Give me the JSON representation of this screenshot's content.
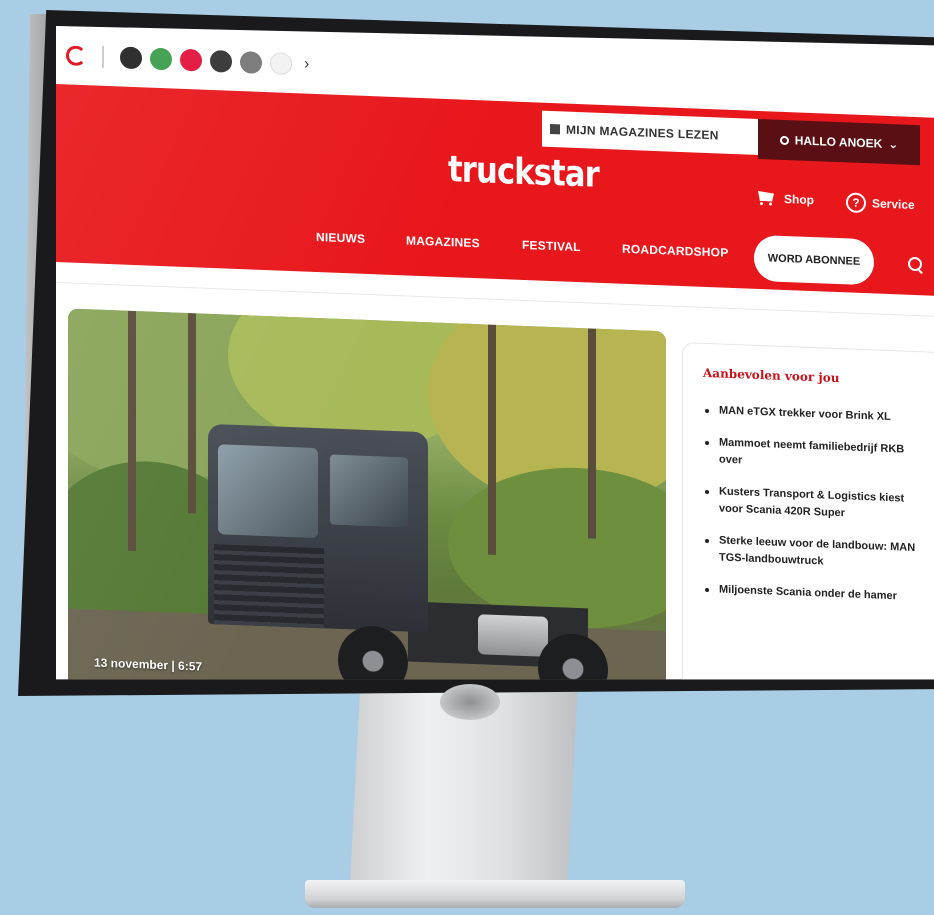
{
  "brand_bar": {
    "brands": [
      {
        "name": "brand-1",
        "label": "",
        "color": "#222222"
      },
      {
        "name": "brand-2",
        "label": "",
        "color": "#3a9d4a"
      },
      {
        "name": "brand-3",
        "label": "",
        "color": "#e2123b"
      },
      {
        "name": "brand-4",
        "label": "",
        "color": "#333333"
      },
      {
        "name": "brand-5",
        "label": "",
        "color": "#555555"
      },
      {
        "name": "brand-6",
        "label": "",
        "color": "#f2f2f2"
      }
    ],
    "more_icon": "chevron-right-icon"
  },
  "header": {
    "magazines_link": "MIJN MAGAZINES LEZEN",
    "user_greeting": "HALLO ANOEK",
    "user_menu_chevron": "⌄",
    "logo": "truckstar",
    "shop_label": "Shop",
    "service_label": "Service",
    "accent_color": "#e8171c",
    "user_menu_color": "#5a0f14"
  },
  "nav": {
    "items": [
      {
        "label": "NIEUWS"
      },
      {
        "label": "MAGAZINES"
      },
      {
        "label": "FESTIVAL"
      },
      {
        "label": "ROADCARDSHOP"
      }
    ],
    "subscribe_label": "WORD ABONNEE"
  },
  "hero": {
    "date": "13 november | 6:57"
  },
  "recommended": {
    "title": "Aanbevolen voor jou",
    "items": [
      {
        "label": "MAN eTGX trekker voor Brink XL"
      },
      {
        "label": "Mammoet neemt familiebedrijf RKB over"
      },
      {
        "label": "Kusters Transport & Logistics kiest voor Scania 420R Super"
      },
      {
        "label": "Sterke leeuw voor de landbouw: MAN TGS-landbouwtruck"
      },
      {
        "label": "Miljoenste Scania onder de hamer"
      }
    ]
  }
}
